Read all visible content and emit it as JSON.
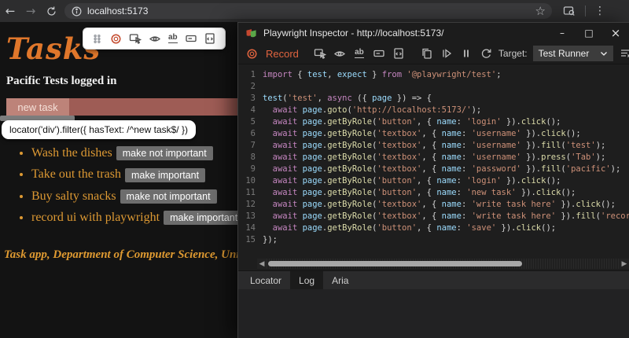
{
  "browser": {
    "url": "localhost:5173"
  },
  "page": {
    "title": "Tasks",
    "login_status": "Pacific Tests logged in",
    "highlight_label": "new task",
    "locator_tooltip": "locator('div').filter({ hasText: /^new task$/ })",
    "tasks": [
      {
        "text": "Wash the dishes",
        "button": "make not important"
      },
      {
        "text": "Take out the trash",
        "button": "make important"
      },
      {
        "text": "Buy salty snacks",
        "button": "make not important"
      },
      {
        "text": "record ui with playwright",
        "button": "make important"
      }
    ],
    "footer": "Task app, Department of Computer Science, University"
  },
  "inspector": {
    "window_title": "Playwright Inspector - http://localhost:5173/",
    "toolbar": {
      "record_label": "Record",
      "target_label": "Target:",
      "target_value": "Test Runner"
    },
    "tabs": [
      {
        "label": "Locator",
        "selected": false
      },
      {
        "label": "Log",
        "selected": true
      },
      {
        "label": "Aria",
        "selected": false
      }
    ],
    "code_lines": [
      [
        [
          "k",
          "import"
        ],
        [
          "p",
          " { "
        ],
        [
          "v",
          "test"
        ],
        [
          "p",
          ", "
        ],
        [
          "v",
          "expect"
        ],
        [
          "p",
          " } "
        ],
        [
          "k",
          "from"
        ],
        [
          "p",
          " "
        ],
        [
          "s",
          "'@playwright/test'"
        ],
        [
          "p",
          ";"
        ]
      ],
      [],
      [
        [
          "v",
          "test"
        ],
        [
          "p",
          "("
        ],
        [
          "s",
          "'test'"
        ],
        [
          "p",
          ", "
        ],
        [
          "k",
          "async"
        ],
        [
          "p",
          " ({ "
        ],
        [
          "v",
          "page"
        ],
        [
          "p",
          " }) => {"
        ]
      ],
      [
        [
          "p",
          "  "
        ],
        [
          "k",
          "await"
        ],
        [
          "p",
          " "
        ],
        [
          "v",
          "page"
        ],
        [
          "p",
          "."
        ],
        [
          "f",
          "goto"
        ],
        [
          "p",
          "("
        ],
        [
          "s",
          "'http://localhost:5173/'"
        ],
        [
          "p",
          ");"
        ]
      ],
      [
        [
          "p",
          "  "
        ],
        [
          "k",
          "await"
        ],
        [
          "p",
          " "
        ],
        [
          "v",
          "page"
        ],
        [
          "p",
          "."
        ],
        [
          "f",
          "getByRole"
        ],
        [
          "p",
          "("
        ],
        [
          "s",
          "'button'"
        ],
        [
          "p",
          ", { "
        ],
        [
          "v",
          "name"
        ],
        [
          "p",
          ": "
        ],
        [
          "s",
          "'login'"
        ],
        [
          "p",
          " })."
        ],
        [
          "f",
          "click"
        ],
        [
          "p",
          "();"
        ]
      ],
      [
        [
          "p",
          "  "
        ],
        [
          "k",
          "await"
        ],
        [
          "p",
          " "
        ],
        [
          "v",
          "page"
        ],
        [
          "p",
          "."
        ],
        [
          "f",
          "getByRole"
        ],
        [
          "p",
          "("
        ],
        [
          "s",
          "'textbox'"
        ],
        [
          "p",
          ", { "
        ],
        [
          "v",
          "name"
        ],
        [
          "p",
          ": "
        ],
        [
          "s",
          "'username'"
        ],
        [
          "p",
          " })."
        ],
        [
          "f",
          "click"
        ],
        [
          "p",
          "();"
        ]
      ],
      [
        [
          "p",
          "  "
        ],
        [
          "k",
          "await"
        ],
        [
          "p",
          " "
        ],
        [
          "v",
          "page"
        ],
        [
          "p",
          "."
        ],
        [
          "f",
          "getByRole"
        ],
        [
          "p",
          "("
        ],
        [
          "s",
          "'textbox'"
        ],
        [
          "p",
          ", { "
        ],
        [
          "v",
          "name"
        ],
        [
          "p",
          ": "
        ],
        [
          "s",
          "'username'"
        ],
        [
          "p",
          " })."
        ],
        [
          "f",
          "fill"
        ],
        [
          "p",
          "("
        ],
        [
          "s",
          "'test'"
        ],
        [
          "p",
          ");"
        ]
      ],
      [
        [
          "p",
          "  "
        ],
        [
          "k",
          "await"
        ],
        [
          "p",
          " "
        ],
        [
          "v",
          "page"
        ],
        [
          "p",
          "."
        ],
        [
          "f",
          "getByRole"
        ],
        [
          "p",
          "("
        ],
        [
          "s",
          "'textbox'"
        ],
        [
          "p",
          ", { "
        ],
        [
          "v",
          "name"
        ],
        [
          "p",
          ": "
        ],
        [
          "s",
          "'username'"
        ],
        [
          "p",
          " })."
        ],
        [
          "f",
          "press"
        ],
        [
          "p",
          "("
        ],
        [
          "s",
          "'Tab'"
        ],
        [
          "p",
          ");"
        ]
      ],
      [
        [
          "p",
          "  "
        ],
        [
          "k",
          "await"
        ],
        [
          "p",
          " "
        ],
        [
          "v",
          "page"
        ],
        [
          "p",
          "."
        ],
        [
          "f",
          "getByRole"
        ],
        [
          "p",
          "("
        ],
        [
          "s",
          "'textbox'"
        ],
        [
          "p",
          ", { "
        ],
        [
          "v",
          "name"
        ],
        [
          "p",
          ": "
        ],
        [
          "s",
          "'password'"
        ],
        [
          "p",
          " })."
        ],
        [
          "f",
          "fill"
        ],
        [
          "p",
          "("
        ],
        [
          "s",
          "'pacific'"
        ],
        [
          "p",
          ");"
        ]
      ],
      [
        [
          "p",
          "  "
        ],
        [
          "k",
          "await"
        ],
        [
          "p",
          " "
        ],
        [
          "v",
          "page"
        ],
        [
          "p",
          "."
        ],
        [
          "f",
          "getByRole"
        ],
        [
          "p",
          "("
        ],
        [
          "s",
          "'button'"
        ],
        [
          "p",
          ", { "
        ],
        [
          "v",
          "name"
        ],
        [
          "p",
          ": "
        ],
        [
          "s",
          "'login'"
        ],
        [
          "p",
          " })."
        ],
        [
          "f",
          "click"
        ],
        [
          "p",
          "();"
        ]
      ],
      [
        [
          "p",
          "  "
        ],
        [
          "k",
          "await"
        ],
        [
          "p",
          " "
        ],
        [
          "v",
          "page"
        ],
        [
          "p",
          "."
        ],
        [
          "f",
          "getByRole"
        ],
        [
          "p",
          "("
        ],
        [
          "s",
          "'button'"
        ],
        [
          "p",
          ", { "
        ],
        [
          "v",
          "name"
        ],
        [
          "p",
          ": "
        ],
        [
          "s",
          "'new task'"
        ],
        [
          "p",
          " })."
        ],
        [
          "f",
          "click"
        ],
        [
          "p",
          "();"
        ]
      ],
      [
        [
          "p",
          "  "
        ],
        [
          "k",
          "await"
        ],
        [
          "p",
          " "
        ],
        [
          "v",
          "page"
        ],
        [
          "p",
          "."
        ],
        [
          "f",
          "getByRole"
        ],
        [
          "p",
          "("
        ],
        [
          "s",
          "'textbox'"
        ],
        [
          "p",
          ", { "
        ],
        [
          "v",
          "name"
        ],
        [
          "p",
          ": "
        ],
        [
          "s",
          "'write task here'"
        ],
        [
          "p",
          " })."
        ],
        [
          "f",
          "click"
        ],
        [
          "p",
          "();"
        ]
      ],
      [
        [
          "p",
          "  "
        ],
        [
          "k",
          "await"
        ],
        [
          "p",
          " "
        ],
        [
          "v",
          "page"
        ],
        [
          "p",
          "."
        ],
        [
          "f",
          "getByRole"
        ],
        [
          "p",
          "("
        ],
        [
          "s",
          "'textbox'"
        ],
        [
          "p",
          ", { "
        ],
        [
          "v",
          "name"
        ],
        [
          "p",
          ": "
        ],
        [
          "s",
          "'write task here'"
        ],
        [
          "p",
          " })."
        ],
        [
          "f",
          "fill"
        ],
        [
          "p",
          "("
        ],
        [
          "s",
          "'recor"
        ]
      ],
      [
        [
          "p",
          "  "
        ],
        [
          "k",
          "await"
        ],
        [
          "p",
          " "
        ],
        [
          "v",
          "page"
        ],
        [
          "p",
          "."
        ],
        [
          "f",
          "getByRole"
        ],
        [
          "p",
          "("
        ],
        [
          "s",
          "'button'"
        ],
        [
          "p",
          ", { "
        ],
        [
          "v",
          "name"
        ],
        [
          "p",
          ": "
        ],
        [
          "s",
          "'save'"
        ],
        [
          "p",
          " })."
        ],
        [
          "f",
          "click"
        ],
        [
          "p",
          "();"
        ]
      ],
      [
        [
          "p",
          "});"
        ]
      ]
    ]
  },
  "colors": {
    "page_heading": "#e0772b",
    "task_text": "#dd9933",
    "highlight_bar": "#9e5c55",
    "highlight_chip": "#bd8379",
    "record_accent": "#e0643f",
    "code_keyword": "#C586C0",
    "code_variable": "#9CDCFE",
    "code_function": "#DCDCAA",
    "code_string": "#CE9178"
  }
}
